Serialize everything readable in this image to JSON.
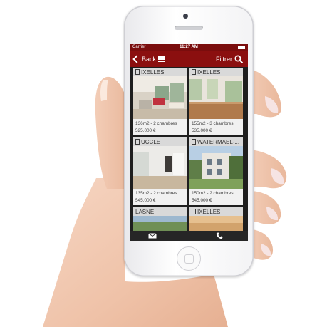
{
  "statusbar": {
    "carrier": "Carrier",
    "time": "11:27 AM"
  },
  "navbar": {
    "back_label": "Back",
    "filter_label": "Filtrer"
  },
  "listings": [
    {
      "city": "IXELLES",
      "area_rooms": "136m2 - 2 chambres",
      "price": "525.000 €"
    },
    {
      "city": "IXELLES",
      "area_rooms": "155m2 - 3 chambres",
      "price": "535.000 €"
    },
    {
      "city": "UCCLE",
      "area_rooms": "135m2 - 2 chambres",
      "price": "545.000 €"
    },
    {
      "city": "WATERMAEL-...",
      "area_rooms": "150m2 - 2 chambres",
      "price": "545.000 €"
    },
    {
      "city": "LASNE",
      "area_rooms": "",
      "price": ""
    },
    {
      "city": "IXELLES",
      "area_rooms": "",
      "price": ""
    }
  ],
  "colors": {
    "accent": "#8b0f0f",
    "tabbar": "#262626"
  },
  "icons": [
    "back-chevron-icon",
    "menu-icon",
    "search-icon",
    "mail-icon",
    "phone-call-icon",
    "building-icon"
  ]
}
